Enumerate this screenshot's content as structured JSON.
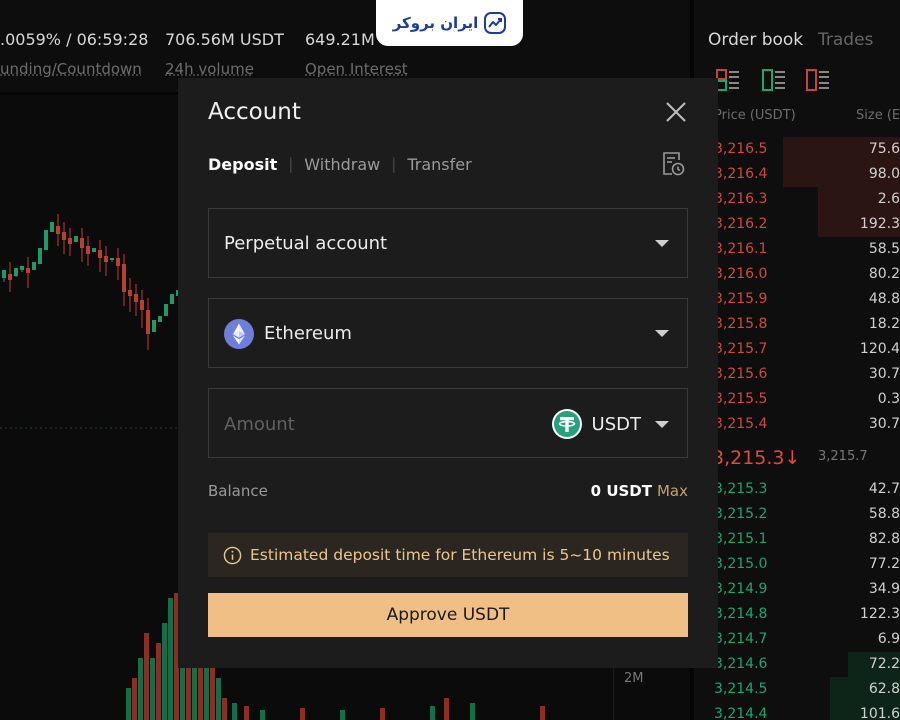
{
  "stats": [
    {
      "value": ".0059% / 06:59:28",
      "label": "unding/Countdown"
    },
    {
      "value": "706.56M USDT",
      "label": "24h volume"
    },
    {
      "value": "649.21M",
      "label": "Open Interest"
    }
  ],
  "logo": {
    "text": "ایران بروکر",
    "icon": "chart-trend-icon"
  },
  "orderbook": {
    "tabs": [
      "Order book",
      "Trades"
    ],
    "price_header": "Price (USDT)",
    "size_header": "Size (E",
    "asks": [
      {
        "price": "3,216.5",
        "size": "75.6",
        "depth": 0.57
      },
      {
        "price": "3,216.4",
        "size": "98.0",
        "depth": 0.57
      },
      {
        "price": "3,216.3",
        "size": "2.6",
        "depth": 0.4
      },
      {
        "price": "3,216.2",
        "size": "192.3",
        "depth": 0.4
      },
      {
        "price": "3,216.1",
        "size": "58.5",
        "depth": 0
      },
      {
        "price": "3,216.0",
        "size": "80.2",
        "depth": 0
      },
      {
        "price": "3,215.9",
        "size": "48.8",
        "depth": 0
      },
      {
        "price": "3,215.8",
        "size": "18.2",
        "depth": 0
      },
      {
        "price": "3,215.7",
        "size": "120.4",
        "depth": 0
      },
      {
        "price": "3,215.6",
        "size": "30.7",
        "depth": 0
      },
      {
        "price": "3,215.5",
        "size": "0.3",
        "depth": 0
      },
      {
        "price": "3,215.4",
        "size": "30.7",
        "depth": 0
      }
    ],
    "last_price": "3,215.3↓",
    "mark_price": "3,215.7",
    "bids": [
      {
        "price": "3,215.3",
        "size": "42.7",
        "depth": 0
      },
      {
        "price": "3,215.2",
        "size": "58.8",
        "depth": 0
      },
      {
        "price": "3,215.1",
        "size": "82.8",
        "depth": 0
      },
      {
        "price": "3,215.0",
        "size": "77.2",
        "depth": 0
      },
      {
        "price": "3,214.9",
        "size": "34.9",
        "depth": 0
      },
      {
        "price": "3,214.8",
        "size": "122.3",
        "depth": 0
      },
      {
        "price": "3,214.7",
        "size": "6.9",
        "depth": 0
      },
      {
        "price": "3,214.6",
        "size": "72.2",
        "depth": 0.25
      },
      {
        "price": "3,214.5",
        "size": "62.8",
        "depth": 0.34
      },
      {
        "price": "3,214.4",
        "size": "101.6",
        "depth": 0.34
      }
    ]
  },
  "volume_axis_label": "2M",
  "modal": {
    "title": "Account",
    "tabs": [
      "Deposit",
      "Withdraw",
      "Transfer"
    ],
    "active_tab": "Deposit",
    "account_select": "Perpetual account",
    "network_select": "Ethereum",
    "amount_placeholder": "Amount",
    "token": "USDT",
    "balance_label": "Balance",
    "balance_value": "0 USDT",
    "max_label": "Max",
    "notice": "Estimated deposit time for Ethereum is 5~10 minutes",
    "approve_label": "Approve USDT",
    "colors": {
      "accent": "#efbf85",
      "notice_text": "#ecc592",
      "ask": "#d04a3a",
      "bid": "#1fa46e"
    }
  }
}
